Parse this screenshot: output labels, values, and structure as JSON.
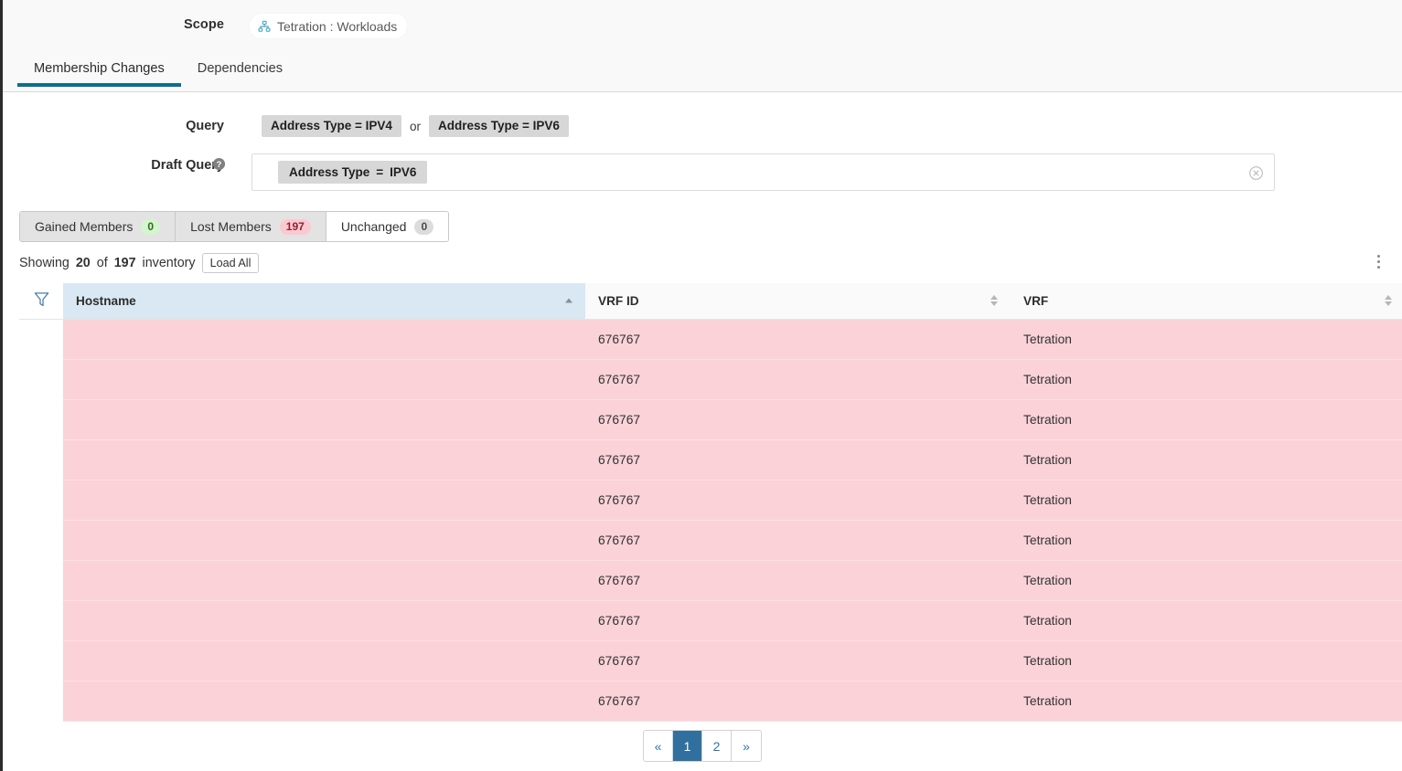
{
  "topbar": {
    "scope_label": "Scope",
    "scope_chip": "Tetration : Workloads",
    "scope_icon": "sitemap-icon"
  },
  "tabs": [
    {
      "label": "Membership Changes",
      "active": true
    },
    {
      "label": "Dependencies",
      "active": false
    }
  ],
  "query": {
    "label": "Query",
    "tokens": [
      "Address Type = IPV4",
      "Address Type = IPV6"
    ],
    "joiner": "or"
  },
  "draft_query": {
    "label": "Draft Query",
    "help_icon": "help-circle-icon",
    "token_field": "Address Type",
    "token_operator": "=",
    "token_value": "IPV6",
    "clear_icon": "clear-circle-icon"
  },
  "member_tabs": [
    {
      "label": "Gained Members",
      "count": "0",
      "badge": "green",
      "active": false
    },
    {
      "label": "Lost Members",
      "count": "197",
      "badge": "red",
      "active": false
    },
    {
      "label": "Unchanged",
      "count": "0",
      "badge": "grey",
      "active": true
    }
  ],
  "summary": {
    "prefix": "Showing",
    "shown": "20",
    "middle": "of",
    "total": "197",
    "suffix": "inventory",
    "load_all_label": "Load All",
    "menu_icon": "kebab-menu-icon"
  },
  "table": {
    "filter_icon": "filter-funnel-icon",
    "columns": [
      {
        "label": "Hostname",
        "sort": "asc"
      },
      {
        "label": "VRF ID",
        "sort": "none"
      },
      {
        "label": "VRF",
        "sort": "none"
      }
    ],
    "rows": [
      {
        "hostname": "",
        "vrf_id": "676767",
        "vrf": "Tetration"
      },
      {
        "hostname": "",
        "vrf_id": "676767",
        "vrf": "Tetration"
      },
      {
        "hostname": "",
        "vrf_id": "676767",
        "vrf": "Tetration"
      },
      {
        "hostname": "",
        "vrf_id": "676767",
        "vrf": "Tetration"
      },
      {
        "hostname": "",
        "vrf_id": "676767",
        "vrf": "Tetration"
      },
      {
        "hostname": "",
        "vrf_id": "676767",
        "vrf": "Tetration"
      },
      {
        "hostname": "",
        "vrf_id": "676767",
        "vrf": "Tetration"
      },
      {
        "hostname": "",
        "vrf_id": "676767",
        "vrf": "Tetration"
      },
      {
        "hostname": "",
        "vrf_id": "676767",
        "vrf": "Tetration"
      },
      {
        "hostname": "",
        "vrf_id": "676767",
        "vrf": "Tetration"
      }
    ]
  },
  "pagination": {
    "first_label": "«",
    "pages": [
      "1",
      "2"
    ],
    "current": "1",
    "last_label": "»"
  },
  "colors": {
    "accent": "#0d6e8c",
    "row_pink": "#fad2d8",
    "sorted_header": "#d9e8f2",
    "pager_active": "#31709e"
  }
}
